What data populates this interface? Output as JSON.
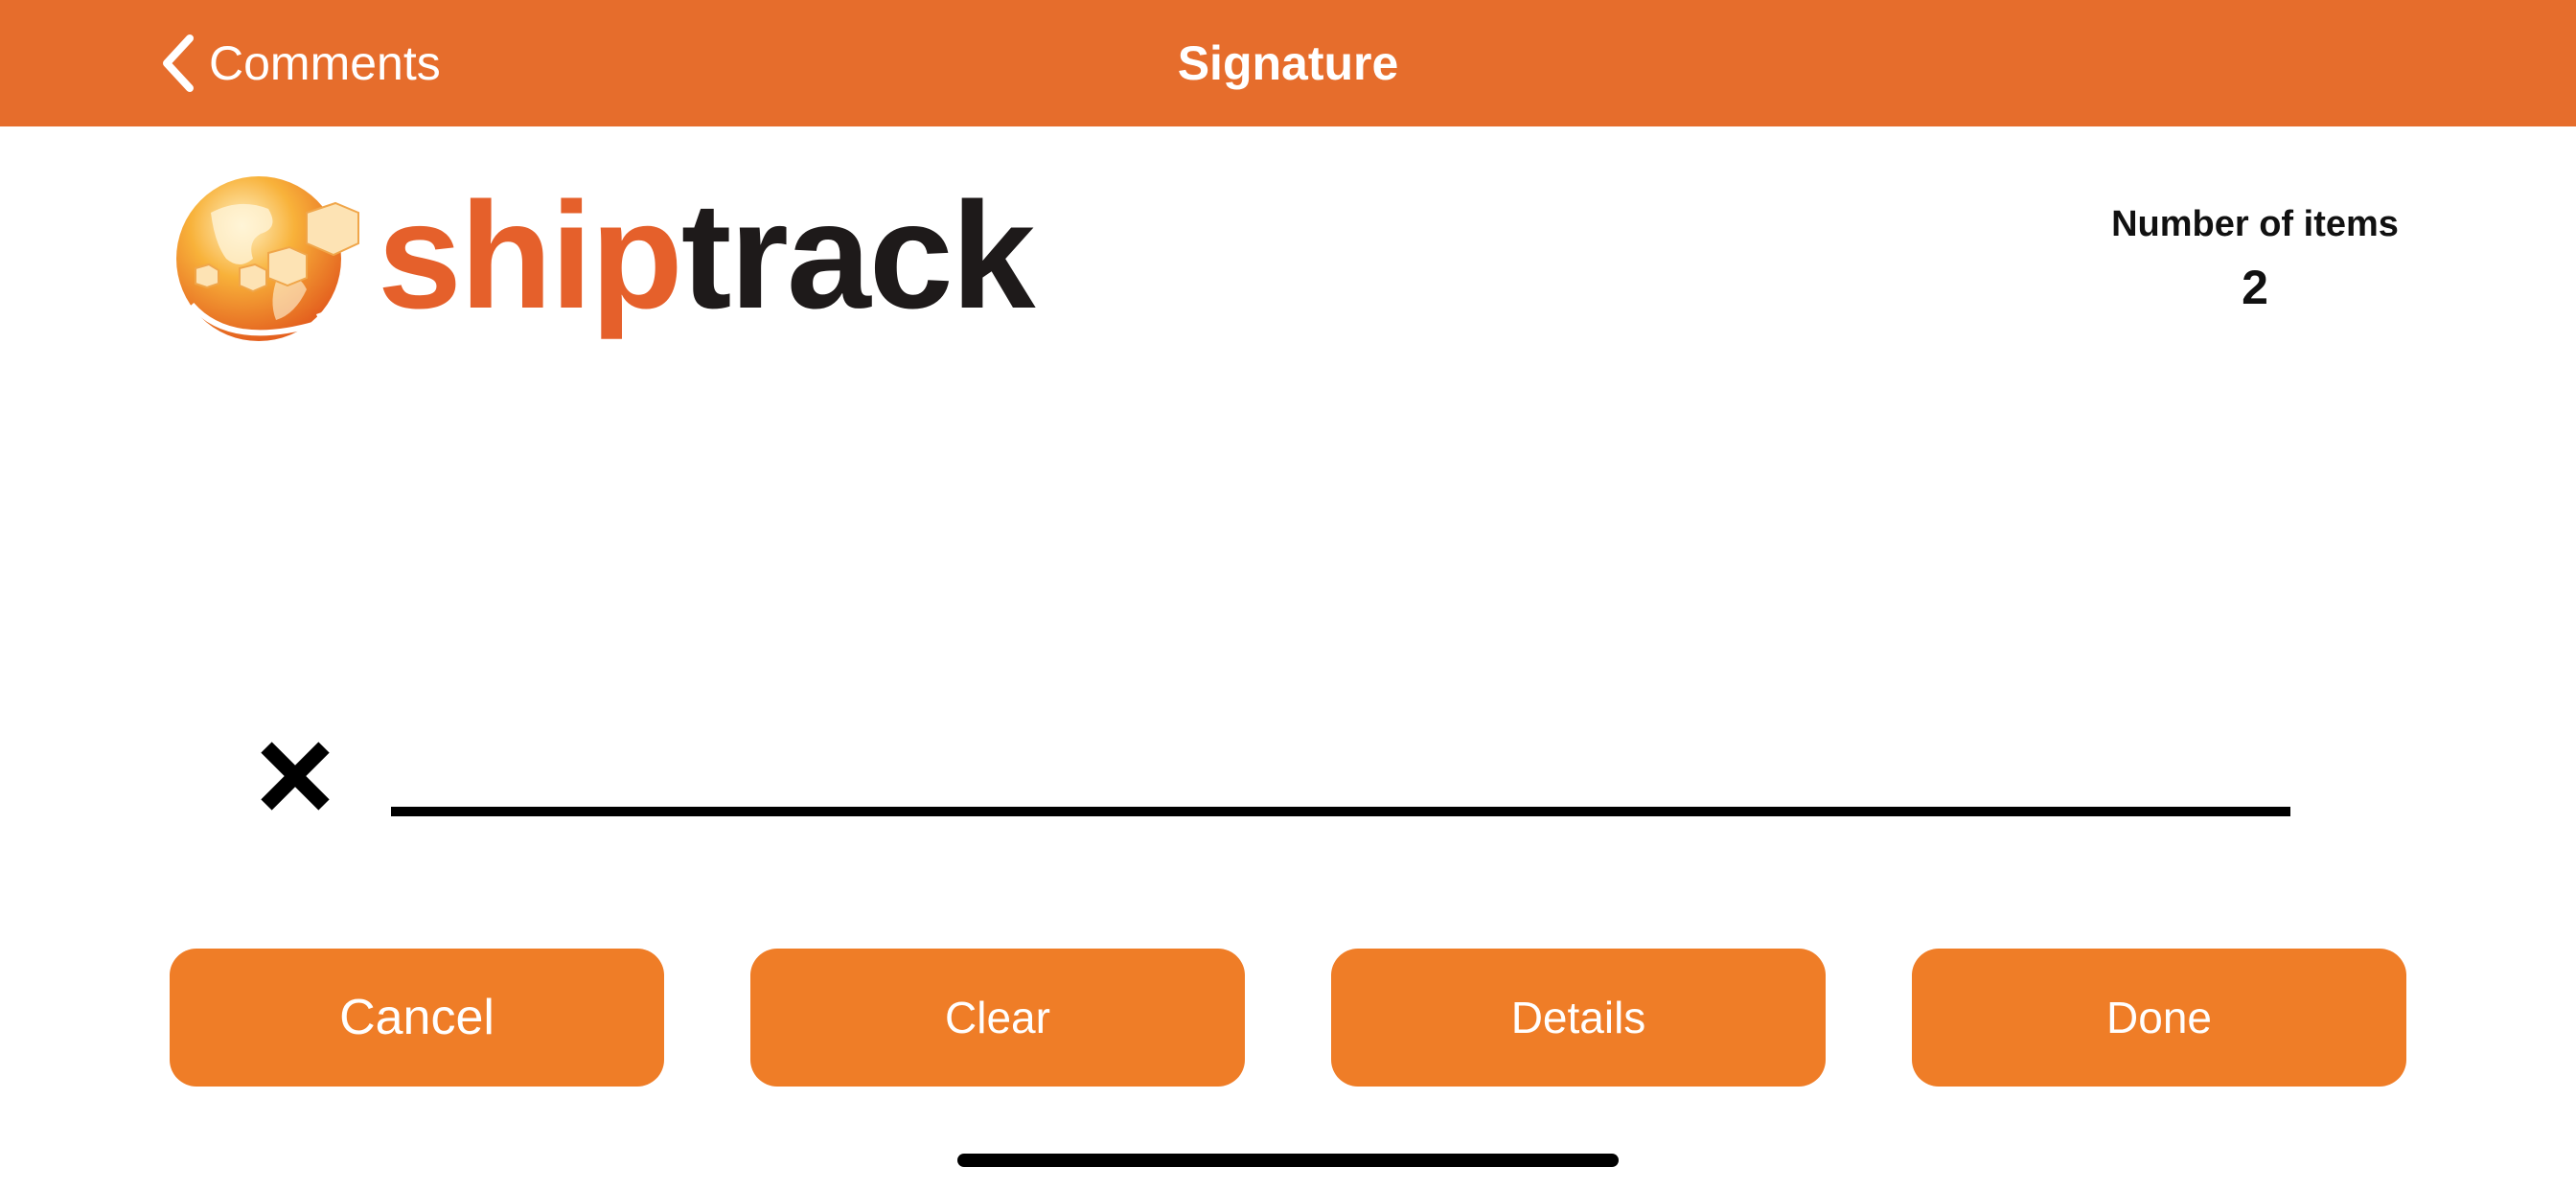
{
  "navbar": {
    "back_label": "Comments",
    "title": "Signature",
    "background_color": "#e66d2c",
    "back_icon": "chevron-left-icon"
  },
  "logo": {
    "text_part1": "ship",
    "text_part2": "track",
    "part1_color": "#e5602b",
    "part2_color": "#1e1a1a",
    "icon": "globe-boxes-icon"
  },
  "items": {
    "label": "Number of items",
    "value": "2"
  },
  "signature": {
    "mark": "✕",
    "mark_icon": "x-mark-icon"
  },
  "buttons": {
    "cancel": "Cancel",
    "clear": "Clear",
    "details": "Details",
    "done": "Done",
    "color": "#ef7d27"
  }
}
